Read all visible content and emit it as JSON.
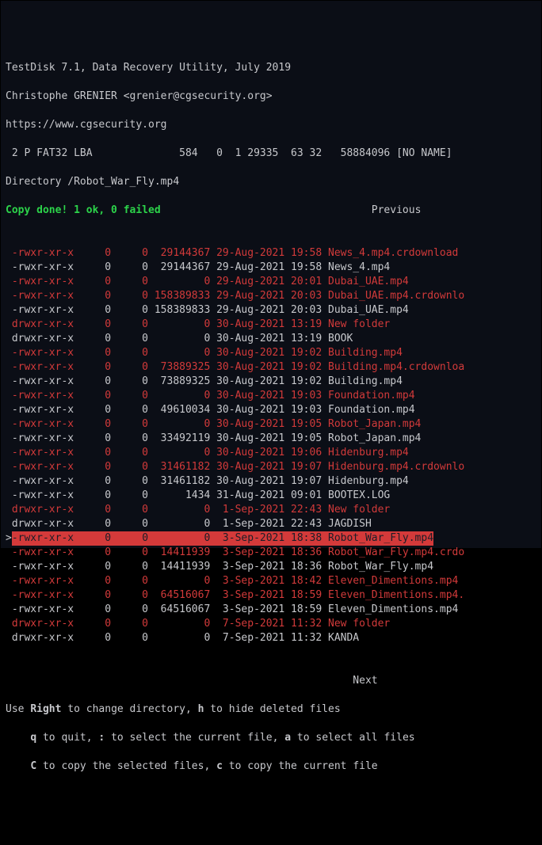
{
  "header": {
    "line1": "TestDisk 7.1, Data Recovery Utility, July 2019",
    "line2": "Christophe GRENIER <grenier@cgsecurity.org>",
    "line3": "https://www.cgsecurity.org",
    "partition": " 2 P FAT32 LBA              584   0  1 29335  63 32   58884096 [NO NAME]",
    "directory": "Directory /Robot_War_Fly.mp4"
  },
  "status": {
    "copy_msg": "Copy done! 1 ok, 0 failed",
    "previous": "                                  Previous",
    "next": "                                                        Next"
  },
  "rows": [
    {
      "deleted": true,
      "dir": false,
      "perm": "-rwxr-xr-x",
      "own": "0",
      "grp": "0",
      "size": "29144367",
      "date": "29-Aug-2021",
      "time": "19:58",
      "name": "News_4.mp4.crdownload"
    },
    {
      "deleted": false,
      "dir": false,
      "perm": "-rwxr-xr-x",
      "own": "0",
      "grp": "0",
      "size": "29144367",
      "date": "29-Aug-2021",
      "time": "19:58",
      "name": "News_4.mp4"
    },
    {
      "deleted": true,
      "dir": false,
      "perm": "-rwxr-xr-x",
      "own": "0",
      "grp": "0",
      "size": "0",
      "date": "29-Aug-2021",
      "time": "20:01",
      "name": "Dubai_UAE.mp4"
    },
    {
      "deleted": true,
      "dir": false,
      "perm": "-rwxr-xr-x",
      "own": "0",
      "grp": "0",
      "size": "158389833",
      "date": "29-Aug-2021",
      "time": "20:03",
      "name": "Dubai_UAE.mp4.crdownlo"
    },
    {
      "deleted": false,
      "dir": false,
      "perm": "-rwxr-xr-x",
      "own": "0",
      "grp": "0",
      "size": "158389833",
      "date": "29-Aug-2021",
      "time": "20:03",
      "name": "Dubai_UAE.mp4"
    },
    {
      "deleted": true,
      "dir": true,
      "perm": "drwxr-xr-x",
      "own": "0",
      "grp": "0",
      "size": "0",
      "date": "30-Aug-2021",
      "time": "13:19",
      "name": "New folder"
    },
    {
      "deleted": false,
      "dir": true,
      "perm": "drwxr-xr-x",
      "own": "0",
      "grp": "0",
      "size": "0",
      "date": "30-Aug-2021",
      "time": "13:19",
      "name": "BOOK"
    },
    {
      "deleted": true,
      "dir": false,
      "perm": "-rwxr-xr-x",
      "own": "0",
      "grp": "0",
      "size": "0",
      "date": "30-Aug-2021",
      "time": "19:02",
      "name": "Building.mp4"
    },
    {
      "deleted": true,
      "dir": false,
      "perm": "-rwxr-xr-x",
      "own": "0",
      "grp": "0",
      "size": "73889325",
      "date": "30-Aug-2021",
      "time": "19:02",
      "name": "Building.mp4.crdownloa"
    },
    {
      "deleted": false,
      "dir": false,
      "perm": "-rwxr-xr-x",
      "own": "0",
      "grp": "0",
      "size": "73889325",
      "date": "30-Aug-2021",
      "time": "19:02",
      "name": "Building.mp4"
    },
    {
      "deleted": true,
      "dir": false,
      "perm": "-rwxr-xr-x",
      "own": "0",
      "grp": "0",
      "size": "0",
      "date": "30-Aug-2021",
      "time": "19:03",
      "name": "Foundation.mp4"
    },
    {
      "deleted": false,
      "dir": false,
      "perm": "-rwxr-xr-x",
      "own": "0",
      "grp": "0",
      "size": "49610034",
      "date": "30-Aug-2021",
      "time": "19:03",
      "name": "Foundation.mp4"
    },
    {
      "deleted": true,
      "dir": false,
      "perm": "-rwxr-xr-x",
      "own": "0",
      "grp": "0",
      "size": "0",
      "date": "30-Aug-2021",
      "time": "19:05",
      "name": "Robot_Japan.mp4"
    },
    {
      "deleted": false,
      "dir": false,
      "perm": "-rwxr-xr-x",
      "own": "0",
      "grp": "0",
      "size": "33492119",
      "date": "30-Aug-2021",
      "time": "19:05",
      "name": "Robot_Japan.mp4"
    },
    {
      "deleted": true,
      "dir": false,
      "perm": "-rwxr-xr-x",
      "own": "0",
      "grp": "0",
      "size": "0",
      "date": "30-Aug-2021",
      "time": "19:06",
      "name": "Hidenburg.mp4"
    },
    {
      "deleted": true,
      "dir": false,
      "perm": "-rwxr-xr-x",
      "own": "0",
      "grp": "0",
      "size": "31461182",
      "date": "30-Aug-2021",
      "time": "19:07",
      "name": "Hidenburg.mp4.crdownlo"
    },
    {
      "deleted": false,
      "dir": false,
      "perm": "-rwxr-xr-x",
      "own": "0",
      "grp": "0",
      "size": "31461182",
      "date": "30-Aug-2021",
      "time": "19:07",
      "name": "Hidenburg.mp4"
    },
    {
      "deleted": false,
      "dir": false,
      "perm": "-rwxr-xr-x",
      "own": "0",
      "grp": "0",
      "size": "1434",
      "date": "31-Aug-2021",
      "time": "09:01",
      "name": "BOOTEX.LOG"
    },
    {
      "deleted": true,
      "dir": true,
      "perm": "drwxr-xr-x",
      "own": "0",
      "grp": "0",
      "size": "0",
      "date": " 1-Sep-2021",
      "time": "22:43",
      "name": "New folder"
    },
    {
      "deleted": false,
      "dir": true,
      "perm": "drwxr-xr-x",
      "own": "0",
      "grp": "0",
      "size": "0",
      "date": " 1-Sep-2021",
      "time": "22:43",
      "name": "JAGDISH"
    },
    {
      "deleted": true,
      "dir": false,
      "selected": true,
      "perm": "-rwxr-xr-x",
      "own": "0",
      "grp": "0",
      "size": "0",
      "date": " 3-Sep-2021",
      "time": "18:38",
      "name": "Robot_War_Fly.mp4"
    },
    {
      "deleted": true,
      "dir": false,
      "perm": "-rwxr-xr-x",
      "own": "0",
      "grp": "0",
      "size": "14411939",
      "date": " 3-Sep-2021",
      "time": "18:36",
      "name": "Robot_War_Fly.mp4.crdo"
    },
    {
      "deleted": false,
      "dir": false,
      "perm": "-rwxr-xr-x",
      "own": "0",
      "grp": "0",
      "size": "14411939",
      "date": " 3-Sep-2021",
      "time": "18:36",
      "name": "Robot_War_Fly.mp4"
    },
    {
      "deleted": true,
      "dir": false,
      "perm": "-rwxr-xr-x",
      "own": "0",
      "grp": "0",
      "size": "0",
      "date": " 3-Sep-2021",
      "time": "18:42",
      "name": "Eleven_Dimentions.mp4"
    },
    {
      "deleted": true,
      "dir": false,
      "perm": "-rwxr-xr-x",
      "own": "0",
      "grp": "0",
      "size": "64516067",
      "date": " 3-Sep-2021",
      "time": "18:59",
      "name": "Eleven_Dimentions.mp4."
    },
    {
      "deleted": false,
      "dir": false,
      "perm": "-rwxr-xr-x",
      "own": "0",
      "grp": "0",
      "size": "64516067",
      "date": " 3-Sep-2021",
      "time": "18:59",
      "name": "Eleven_Dimentions.mp4"
    },
    {
      "deleted": true,
      "dir": true,
      "perm": "drwxr-xr-x",
      "own": "0",
      "grp": "0",
      "size": "0",
      "date": " 7-Sep-2021",
      "time": "11:32",
      "name": "New folder"
    },
    {
      "deleted": false,
      "dir": true,
      "perm": "drwxr-xr-x",
      "own": "0",
      "grp": "0",
      "size": "0",
      "date": " 7-Sep-2021",
      "time": "11:32",
      "name": "KANDA"
    }
  ],
  "help": {
    "right": "Right",
    "right_txt": " to change directory, ",
    "h": "h",
    "h_txt": " to hide deleted files",
    "q": "q",
    "q_txt": " to quit, ",
    "colon": ":",
    "colon_txt": " to select the current file, ",
    "a": "a",
    "a_txt": " to select all files",
    "C": "C",
    "C_txt": " to copy the selected files, ",
    "c": "c",
    "c_txt": " to copy the current file"
  }
}
